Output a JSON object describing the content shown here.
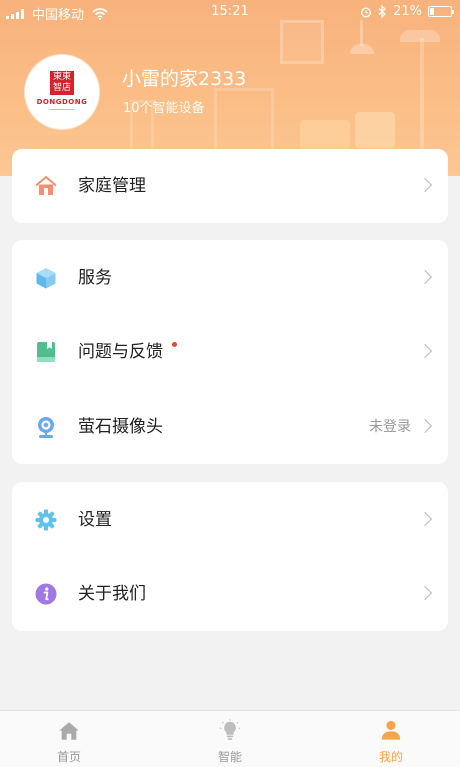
{
  "status_bar": {
    "carrier": "中国移动",
    "time": "15:21",
    "battery": "21%",
    "battery_level": 0.21
  },
  "profile": {
    "home_name": "小雷的家2333",
    "device_count": "10个智能设备",
    "logo_text": "DONGDONG",
    "logo_badge": "東東\n智店"
  },
  "groups": [
    {
      "items": [
        {
          "label": "家庭管理",
          "icon": "house-icon"
        }
      ]
    },
    {
      "items": [
        {
          "label": "服务",
          "icon": "cube-icon"
        },
        {
          "label": "问题与反馈",
          "icon": "book-icon",
          "badge": "red-dot"
        },
        {
          "label": "萤石摄像头",
          "icon": "camera-icon",
          "status": "未登录"
        }
      ]
    },
    {
      "items": [
        {
          "label": "设置",
          "icon": "gear-icon"
        },
        {
          "label": "关于我们",
          "icon": "info-icon"
        }
      ]
    }
  ],
  "tabbar": {
    "active": "我的",
    "tabs": [
      {
        "label": "首页",
        "icon": "home-icon"
      },
      {
        "label": "智能",
        "icon": "lightbulb-icon"
      },
      {
        "label": "我的",
        "icon": "person-icon"
      }
    ]
  },
  "colors": {
    "accent": "#f7a44c",
    "header": "#fbbd86",
    "inactive_tab": "#9a9a9a"
  }
}
